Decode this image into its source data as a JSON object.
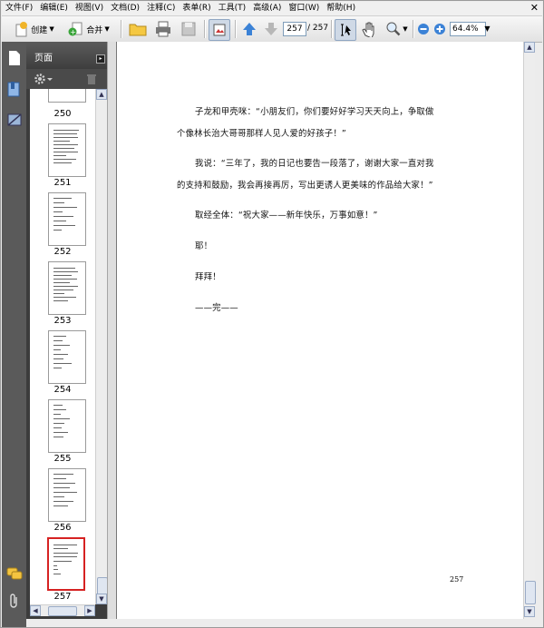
{
  "menu": [
    "文件(F)",
    "编辑(E)",
    "视图(V)",
    "文档(D)",
    "注释(C)",
    "表单(R)",
    "工具(T)",
    "高级(A)",
    "窗口(W)",
    "帮助(H)"
  ],
  "toolbar": {
    "create_label": "创建",
    "merge_label": "合并",
    "page_current": "257",
    "page_total": "/ 257",
    "zoom": "64.4%"
  },
  "panel": {
    "title": "页面",
    "thumbnails": [
      {
        "label": "250",
        "selected": false
      },
      {
        "label": "251",
        "selected": false
      },
      {
        "label": "252",
        "selected": false
      },
      {
        "label": "253",
        "selected": false
      },
      {
        "label": "254",
        "selected": false
      },
      {
        "label": "255",
        "selected": false
      },
      {
        "label": "256",
        "selected": false
      },
      {
        "label": "257",
        "selected": true
      }
    ]
  },
  "document": {
    "lines": [
      "子龙和甲壳咪：“小朋友们，你们要好好学习天天向上，争取做",
      "个像林长治大哥哥那样人见人爱的好孩子！”",
      "我说：“三年了，我的日记也要告一段落了，谢谢大家一直对我",
      "的支持和鼓励，我会再接再厉，写出更诱人更美味的作品给大家！”",
      "取经全体：“祝大家——新年快乐，万事如意！”",
      "耶！",
      "拜拜！",
      "——完——"
    ],
    "page_number": "257"
  },
  "colors": {
    "selected_thumb_border": "#d62222",
    "panel_bg": "#3c3c3c",
    "nav_strip": "#5a5a5a"
  }
}
